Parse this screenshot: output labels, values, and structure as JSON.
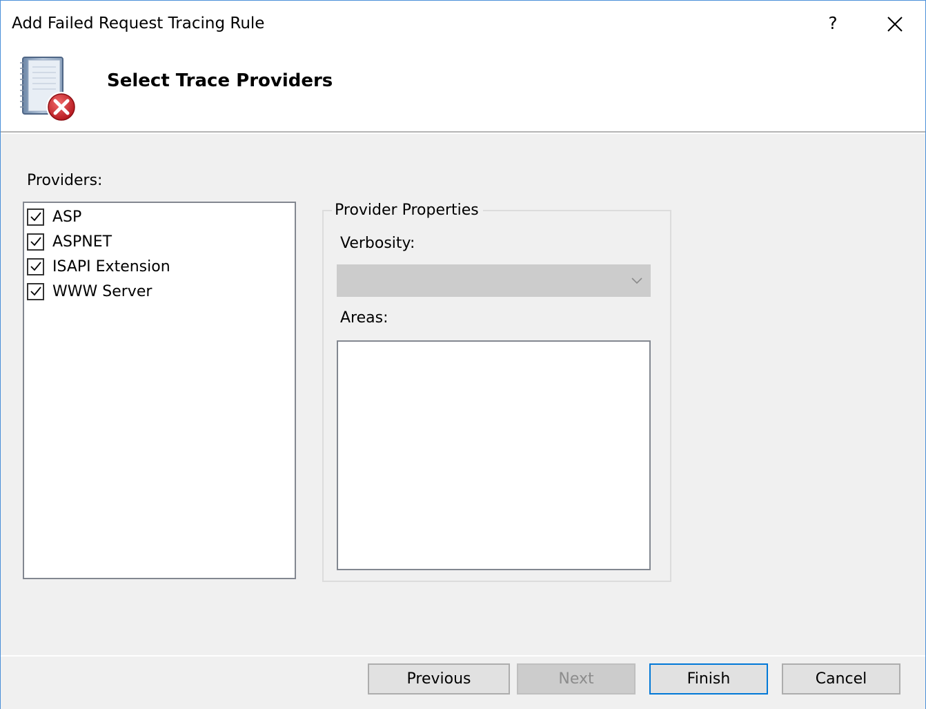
{
  "window": {
    "title": "Add Failed Request Tracing Rule",
    "help_label": "?",
    "accent_color": "#0078d7"
  },
  "header": {
    "title": "Select Trace Providers",
    "icon": "log-book-error-icon"
  },
  "providers": {
    "label": "Providers:",
    "items": [
      {
        "label": "ASP",
        "checked": true
      },
      {
        "label": "ASPNET",
        "checked": true
      },
      {
        "label": "ISAPI Extension",
        "checked": true
      },
      {
        "label": "WWW Server",
        "checked": true
      }
    ]
  },
  "properties": {
    "legend": "Provider Properties",
    "verbosity_label": "Verbosity:",
    "verbosity_value": "",
    "areas_label": "Areas:"
  },
  "buttons": {
    "previous": "Previous",
    "next": "Next",
    "finish": "Finish",
    "cancel": "Cancel"
  }
}
